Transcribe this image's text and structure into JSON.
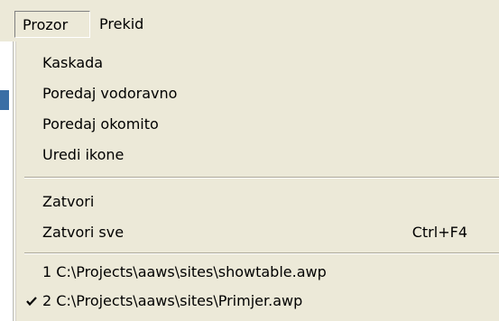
{
  "menubar": {
    "items": [
      {
        "label": "Prozor"
      },
      {
        "label": "Prekid"
      }
    ]
  },
  "menu": {
    "groups": [
      {
        "items": [
          {
            "label": "Kaskada"
          },
          {
            "label": "Poredaj vodoravno"
          },
          {
            "label": "Poredaj okomito"
          },
          {
            "label": "Uredi ikone"
          }
        ]
      },
      {
        "items": [
          {
            "label": "Zatvori"
          },
          {
            "label": "Zatvori sve",
            "shortcut": "Ctrl+F4"
          }
        ]
      },
      {
        "items": [
          {
            "label": "1 C:\\Projects\\aaws\\sites\\showtable.awp",
            "checked": false
          },
          {
            "label": "2 C:\\Projects\\aaws\\sites\\Primjer.awp",
            "checked": true
          }
        ]
      }
    ]
  },
  "icons": {
    "checkmark": "check-icon"
  },
  "colors": {
    "menu_bg": "#ece9d8",
    "separator_dark": "#aca899",
    "separator_light": "#ffffff"
  }
}
